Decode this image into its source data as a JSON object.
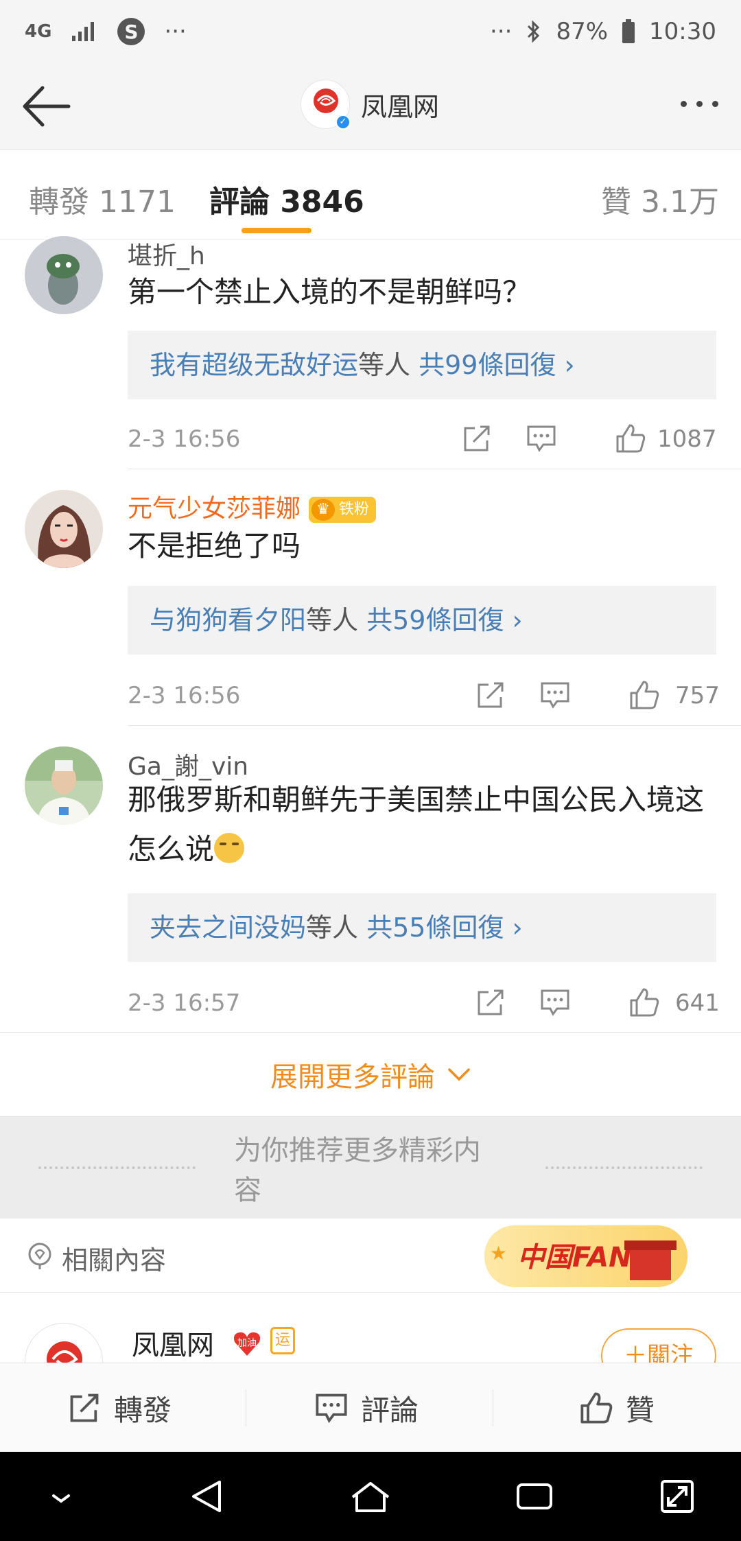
{
  "status_bar": {
    "network": "4G",
    "app_badge": "S",
    "left_dots": "···",
    "right_dots": "···",
    "battery": "87%",
    "time": "10:30"
  },
  "nav": {
    "title": "凤凰网"
  },
  "tabs": [
    {
      "label": "轉發 1171",
      "active": false
    },
    {
      "label": "評論 3846",
      "active": true
    },
    {
      "label": "贊 3.1万",
      "active": false
    }
  ],
  "comments": [
    {
      "user": "堪折_h",
      "text": "第一个禁止入境的不是朝鲜吗？",
      "reply_user": "我有超级无敌好运",
      "reply_mid": "等人",
      "reply_count": "共99條回復 ›",
      "time": "2-3 16:56",
      "likes": "1087"
    },
    {
      "user": "元气少女莎菲娜",
      "badge": "铁粉",
      "text": "不是拒绝了吗",
      "reply_user": "与狗狗看夕阳",
      "reply_mid": "等人",
      "reply_count": "共59條回復 ›",
      "time": "2-3 16:56",
      "likes": "757"
    },
    {
      "user": "Ga_謝_vin",
      "text": "那俄罗斯和朝鲜先于美国禁止中国公民入境这怎么说",
      "reply_user": "夹去之间没妈",
      "reply_mid": "等人",
      "reply_count": "共55條回復 ›",
      "time": "2-3 16:57",
      "likes": "641"
    }
  ],
  "expand_label": "展開更多評論",
  "recommend_label": "为你推荐更多精彩内容",
  "related": {
    "label": "相關內容",
    "banner_text": "中国FANS"
  },
  "feed": {
    "name": "凤凰网",
    "badge1": "加油",
    "badge2": "运",
    "follow_label": "＋關注"
  },
  "bottom_bar": {
    "repost": "轉發",
    "comment": "評論",
    "like": "贊"
  },
  "colors": {
    "accent": "#f8a017",
    "link_blue": "#4a7fb5",
    "vip_name": "#f26b1d",
    "expand_orange": "#f08c1b"
  }
}
